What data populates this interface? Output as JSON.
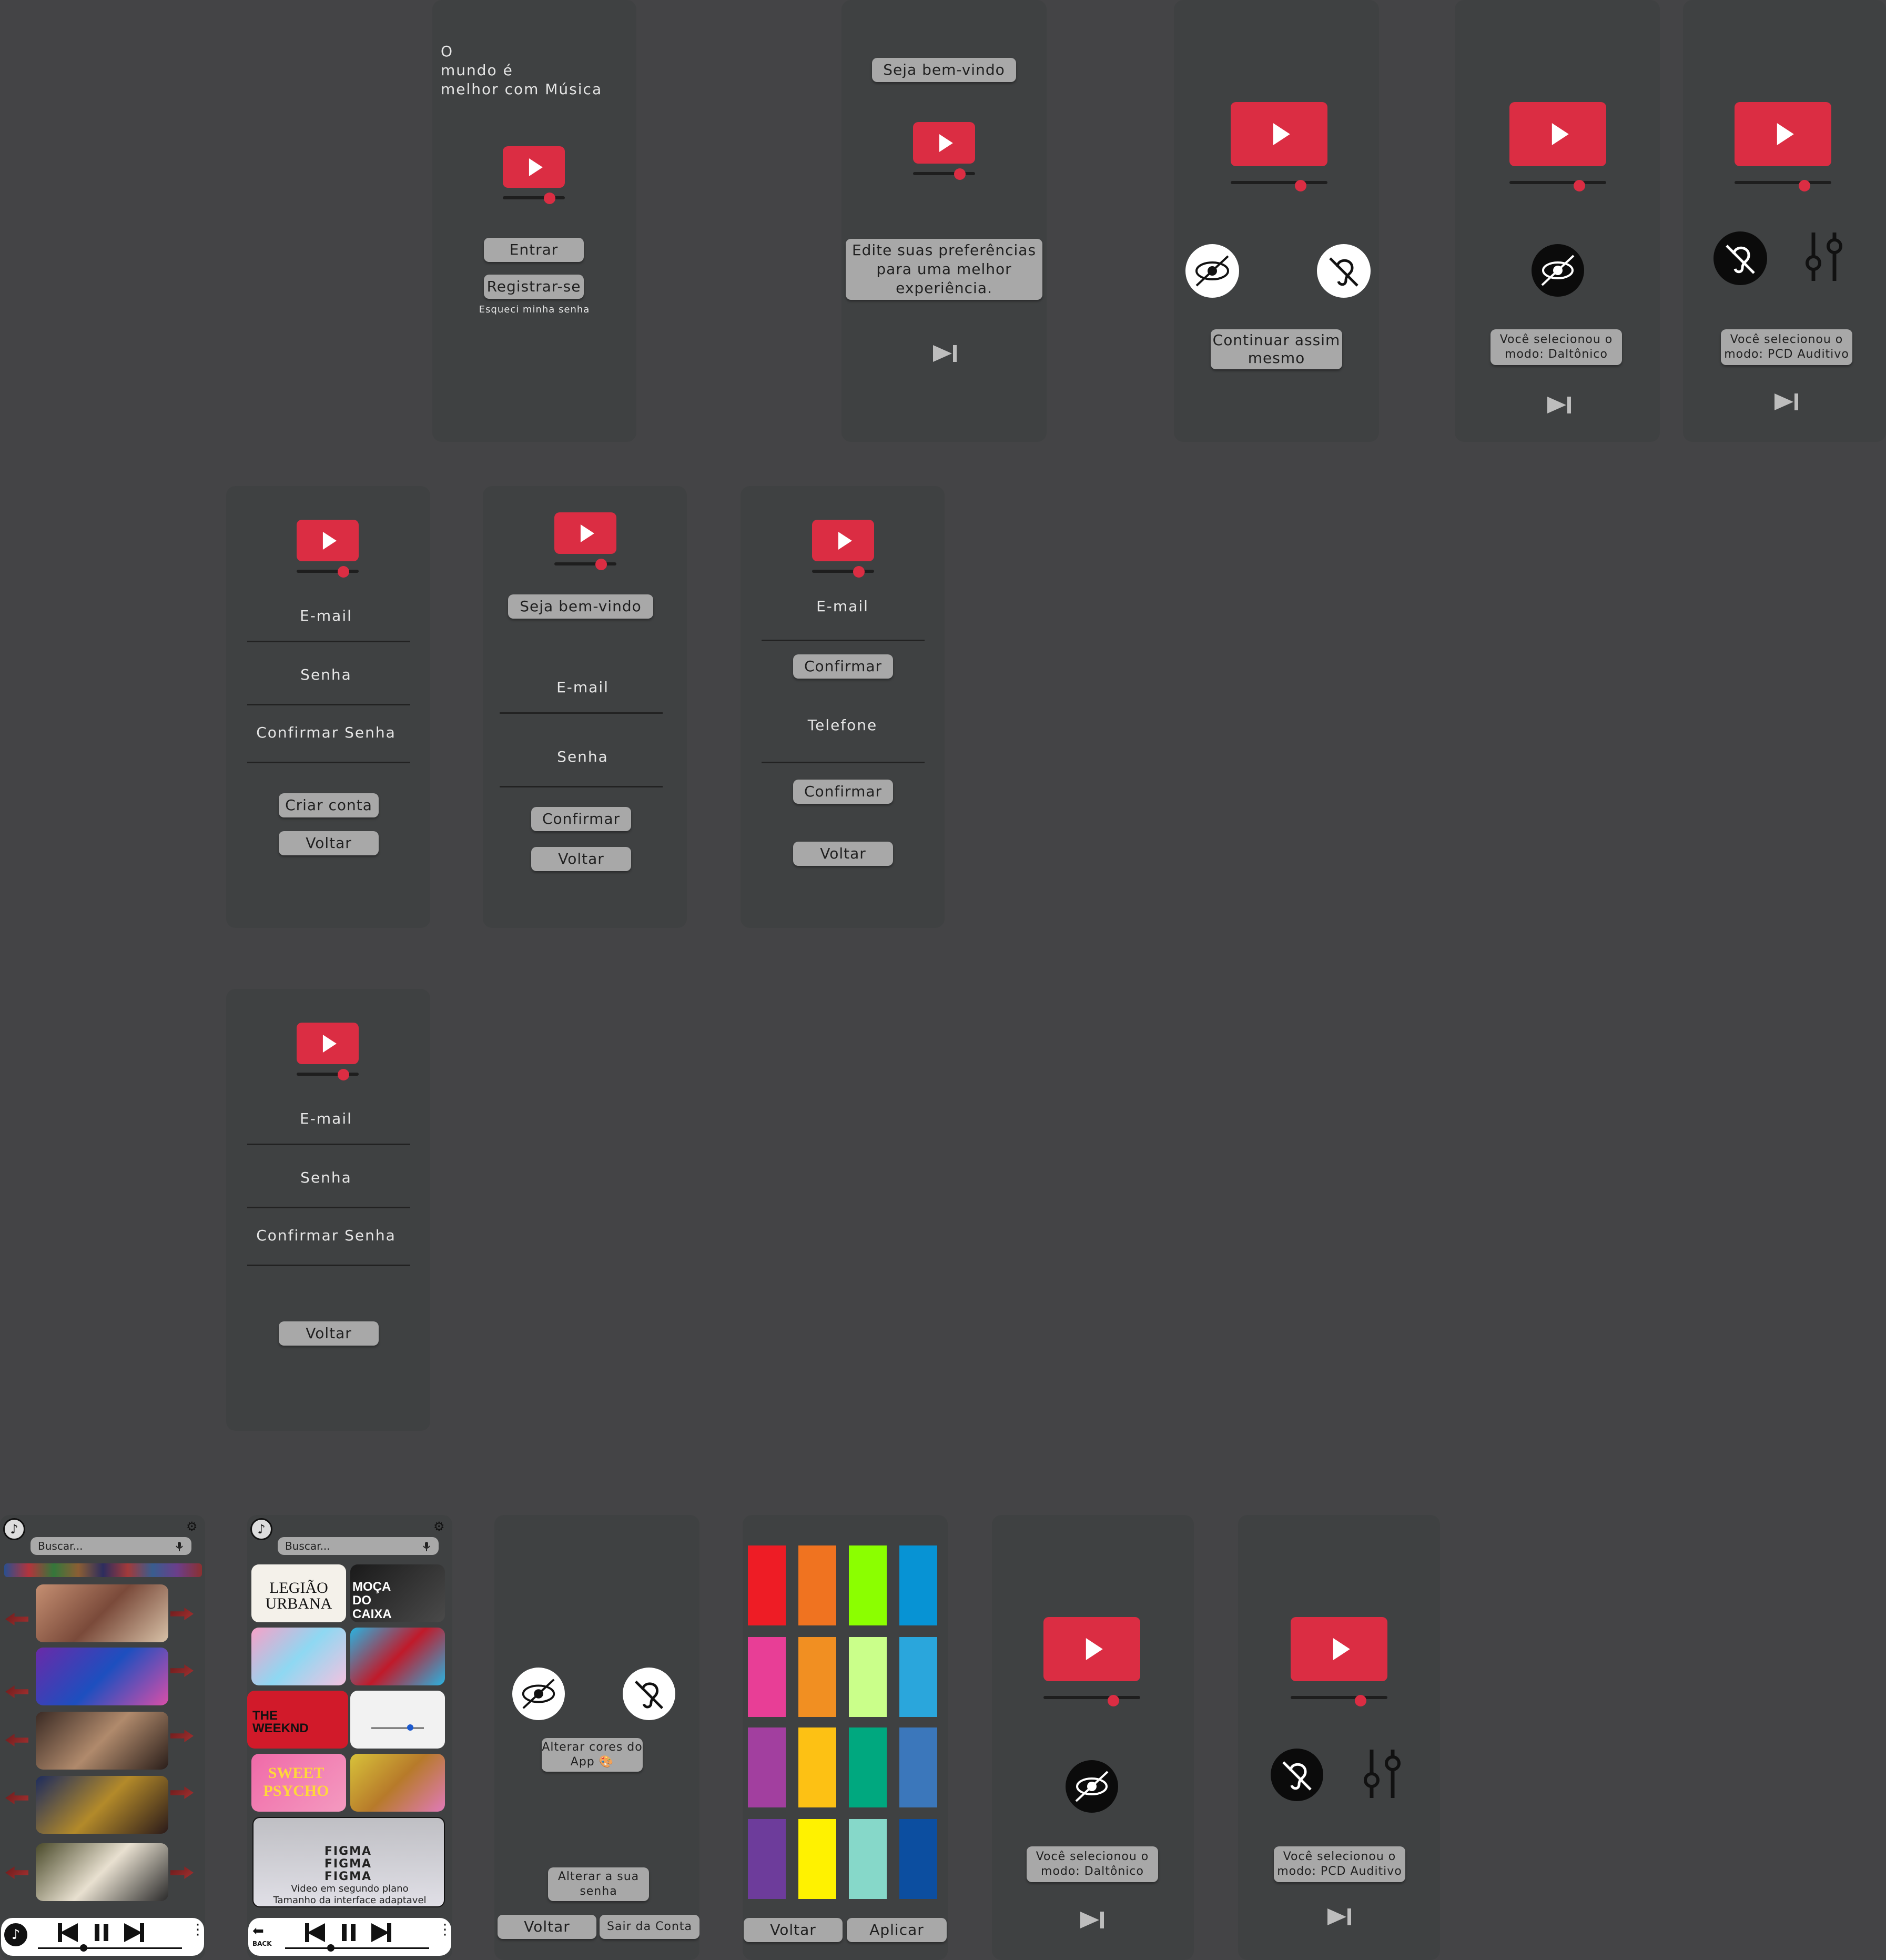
{
  "welcome": {
    "tagline_line1": "O",
    "tagline_line2": "mundo é",
    "tagline_line3": "melhor com Música",
    "enter": "Entrar",
    "register": "Registrar-se",
    "forgot": "Esqueci minha senha"
  },
  "prefs_intro": {
    "greeting": "Seja bem-vindo",
    "message": "Edite suas preferências para uma melhor experiência."
  },
  "accessibility_choice": {
    "continue": "Continuar assim mesmo"
  },
  "mode_colorblind": {
    "text": "Você selecionou o modo: Daltônico"
  },
  "mode_hearing": {
    "text": "Você selecionou o modo: PCD Auditivo"
  },
  "register_form": {
    "email": "E-mail",
    "password": "Senha",
    "confirm_password": "Confirmar Senha",
    "create": "Criar conta",
    "back": "Voltar"
  },
  "login_form": {
    "greeting": "Seja bem-vindo",
    "email": "E-mail",
    "password": "Senha",
    "confirm": "Confirmar",
    "back": "Voltar"
  },
  "recover_form": {
    "email": "E-mail",
    "confirm1": "Confirmar",
    "phone": "Telefone",
    "confirm2": "Confirmar",
    "back": "Voltar"
  },
  "register_form_2": {
    "email": "E-mail",
    "password": "Senha",
    "confirm_password": "Confirmar Senha",
    "back": "Voltar"
  },
  "home_feed": {
    "search_placeholder": "Buscar..."
  },
  "home_grid": {
    "search_placeholder": "Buscar...",
    "thumb_text_1": "LEGIÃO URBANA",
    "thumb_text_2": "MOÇA DO CAIXA",
    "thumb_text_4": "THE WEEKND",
    "thumb_text_5": "SWEET PSYCHO",
    "thumb_text_6": "FIGMA FIGMA FIGMA",
    "overlay_line1": "Video em segundo plano",
    "overlay_line2": "Tamanho da interface adaptavel",
    "back_label": "BACK"
  },
  "settings": {
    "change_colors": "Alterar cores do App",
    "change_password": "Alterar a sua senha",
    "back": "Voltar",
    "logout": "Sair da Conta"
  },
  "palette": {
    "back": "Voltar",
    "apply": "Aplicar",
    "colors": [
      [
        "#ee1c25",
        "#f07320",
        "#8bff00",
        "#0793d4"
      ],
      [
        "#e83e96",
        "#f18f22",
        "#caff8a",
        "#2aa6dc"
      ],
      [
        "#a23f9f",
        "#fdc114",
        "#00a87f",
        "#3b77bb"
      ],
      [
        "#6d3c9b",
        "#fff200",
        "#86d8c9",
        "#0c4ea0"
      ]
    ]
  },
  "mode_colorblind_2": {
    "text": "Você selecionou o modo: Daltônico"
  },
  "mode_hearing_2": {
    "text": "Você selecionou o modo: PCD Auditivo"
  },
  "colors": {
    "background": "#444446",
    "screen": "#3f4142",
    "brand_red": "#db2d43",
    "button_gray": "#a8a8a8"
  }
}
